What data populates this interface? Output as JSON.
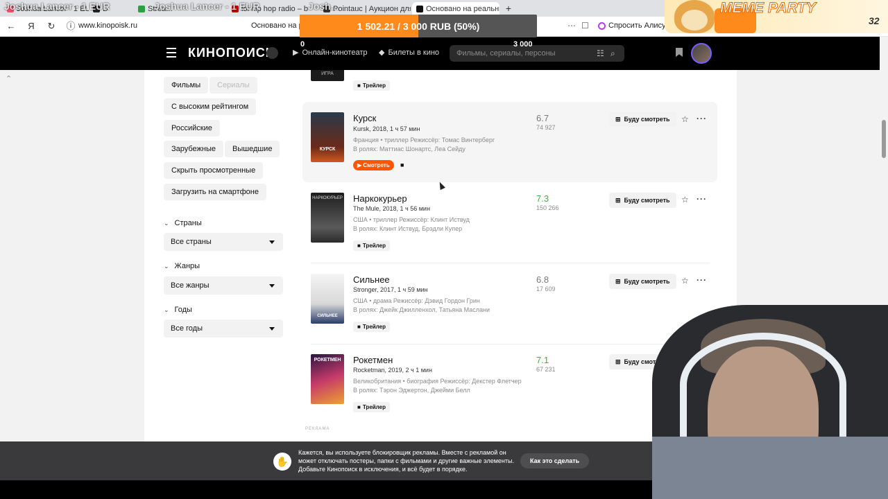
{
  "browser": {
    "tabs": [
      {
        "label": "Joshua Lancer - 1 EUR",
        "color": "#ff4d6d"
      },
      {
        "label": "D",
        "color": "#222222"
      },
      {
        "label": "Strea...",
        "color": "#2ea043"
      },
      {
        "label": "Joshua Lancer - 1 EUR",
        "color": "#ff4d6d"
      },
      {
        "label": "ioi hip hop radio – b",
        "color": "#cc0000"
      },
      {
        "label": "Josh...",
        "color": "#555555"
      },
      {
        "label": "Pointauc | Аукцион для",
        "color": "#333333"
      },
      {
        "label": "Основано на реальны",
        "color": "#111111",
        "active": true
      }
    ],
    "url": "www.kinopoisk.ru",
    "page_title": "Основано на ре",
    "alice_label": "Спросить Алису"
  },
  "header": {
    "logo": "КИНОПОИСК",
    "online_cinema": "Онлайн-кинотеатр",
    "tickets": "Билеты в кино",
    "search_placeholder": "Фильмы, сериалы, персоны"
  },
  "filters": {
    "chips": [
      "Фильмы",
      "Сериалы",
      "С высоким рейтингом",
      "Российские",
      "Зарубежные",
      "Вышедшие",
      "Скрыть просмотренные",
      "Загрузить на смартфоне"
    ],
    "facets": [
      {
        "label": "Страны",
        "value": "Все страны"
      },
      {
        "label": "Жанры",
        "value": "Все жанры"
      },
      {
        "label": "Годы",
        "value": "Все годы"
      }
    ]
  },
  "films": [
    {
      "title": "Курск",
      "subtitle": "Kursk, 2018, 1 ч 57 мин",
      "meta": "Франция • триллер   Режиссёр: Томас Винтерберг",
      "cast": "В ролях: Маттиас Шонартс, Леа Сейду",
      "rating": "6.7",
      "votes": "74 927",
      "action": "Смотреть",
      "poster_text": "КУРСК"
    },
    {
      "title": "Наркокурьер",
      "subtitle": "The Mule, 2018, 1 ч 56 мин",
      "meta": "США • триллер   Режиссёр: Клинт Иствуд",
      "cast": "В ролях: Клинт Иствуд, Брэдли Купер",
      "rating": "7.3",
      "votes": "150 266",
      "action": "Трейлер",
      "poster_text": "НАРКОКУРЬЕР"
    },
    {
      "title": "Сильнее",
      "subtitle": "Stronger, 2017, 1 ч 59 мин",
      "meta": "США • драма   Режиссёр: Дэвид Гордон Грин",
      "cast": "В ролях: Джейк Джилленхол, Татьяна Маслани",
      "rating": "6.8",
      "votes": "17 609",
      "action": "Трейлер",
      "poster_text": "СИЛЬНЕЕ"
    },
    {
      "title": "Рокетмен",
      "subtitle": "Rocketman, 2019, 2 ч 1 мин",
      "meta": "Великобритания • биография   Режиссёр: Декстер Флетчер",
      "cast": "В ролях: Тэрон Эджертон, Джейми Белл",
      "rating": "7.1",
      "votes": "67 231",
      "action": "Трейлер",
      "poster_text": "РОКЕТМЕН"
    }
  ],
  "prev_film": {
    "poster_text": "ИГРА",
    "action": "Трейлер"
  },
  "will_watch_label": "Буду смотреть",
  "ad_label": "РЕКЛАМА",
  "adblock": {
    "text": "Кажется, вы используете блокировщик рекламы. Вместе с рекламой он может отключать постеры, папки с фильмами и другие важные элементы. Добавьте Кинопоиск в исключения, и всё будет в порядке.",
    "button": "Как это сделать"
  },
  "overlay": {
    "nick_left": "Joshua Lancer - 1 EUR",
    "nick_mid": "Joshua Lancer - 1 EUR",
    "nick_right": "Josh...",
    "donation": "1 502.21 / 3 000 RUB (50%)",
    "donation_progress": 0.5,
    "donation_min": "0",
    "donation_max": "3 000",
    "meme_title": "MEME PARTY",
    "meme_count": "32"
  },
  "colors": {
    "accent_orange": "#ff5500",
    "rating_good": "#3bb33b",
    "rating_mid": "#777777"
  }
}
